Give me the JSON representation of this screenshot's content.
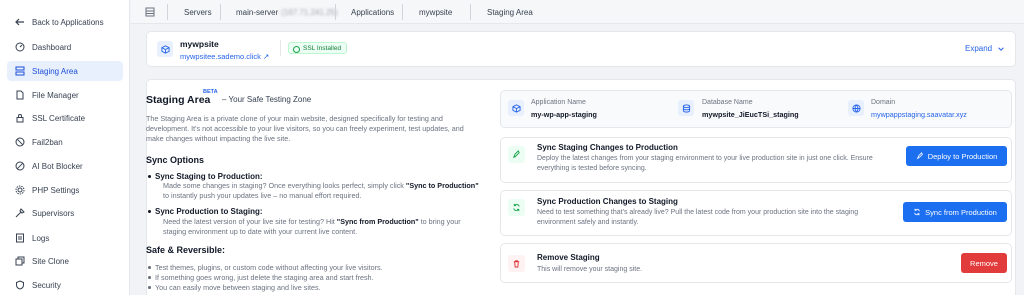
{
  "sidebar": {
    "back_label": "Back to Applications",
    "items": [
      {
        "label": "Dashboard",
        "icon": "dashboard-icon"
      },
      {
        "label": "Staging Area",
        "icon": "staging-icon"
      },
      {
        "label": "File Manager",
        "icon": "file-icon"
      },
      {
        "label": "SSL Certificate",
        "icon": "lock-icon"
      },
      {
        "label": "Fail2ban",
        "icon": "ban-icon"
      },
      {
        "label": "AI Bot Blocker",
        "icon": "block-icon"
      },
      {
        "label": "PHP Settings",
        "icon": "gear-icon"
      },
      {
        "label": "Supervisors",
        "icon": "tools-icon"
      },
      {
        "label": "Logs",
        "icon": "logs-icon"
      },
      {
        "label": "Site Clone",
        "icon": "clone-icon"
      },
      {
        "label": "Security",
        "icon": "shield-icon"
      }
    ],
    "active": "Staging Area"
  },
  "breadcrumb": {
    "servers": "Servers",
    "server": "main-server",
    "server_ip": "(167.71.241.25)",
    "applications": "Applications",
    "app": "mywpsite",
    "current": "Staging Area"
  },
  "site": {
    "name": "mywpsite",
    "url": "mywpsitee.sademo.click",
    "ssl_badge": "SSL Installed",
    "expand_label": "Expand"
  },
  "intro": {
    "title": "Staging Area",
    "beta": "BETA",
    "subtitle": "– Your Safe Testing Zone",
    "lines": [
      "The Staging Area is a private clone of your main website, designed specifically for testing and",
      "development. It's not accessible to your live visitors, so you can freely experiment, test updates, and",
      "make changes without impacting the live site."
    ]
  },
  "sync_options": {
    "heading": "Sync Options",
    "to_prod_title": "Sync Staging to Production:",
    "to_prod_line1": "Made some changes in staging? Once everything looks perfect, simply click ",
    "to_prod_strong": "\"Sync to Production\"",
    "to_prod_line2": "to instantly push your updates live – no manual effort required.",
    "to_staging_title": "Sync Production to Staging:",
    "to_staging_line1a": "Need the latest version of your live site for testing? Hit ",
    "to_staging_strong": "\"Sync from Production\"",
    "to_staging_line1b": " to bring your",
    "to_staging_line2": "staging environment up to date with your current live content."
  },
  "safe": {
    "heading": "Safe & Reversible:",
    "bullets": [
      "Test themes, plugins, or custom code without affecting your live visitors.",
      "If something goes wrong, just delete the staging area and start fresh.",
      "You can easily move between staging and live sites."
    ]
  },
  "staging_info": {
    "app_label": "Application Name",
    "app_value": "my-wp-app-staging",
    "db_label": "Database Name",
    "db_value": "mywpsite_JiEucTSi_staging",
    "domain_label": "Domain",
    "domain_value": "mywpappstaging.saavatar.xyz"
  },
  "actions": {
    "deploy": {
      "title": "Sync Staging Changes to Production",
      "desc1": "Deploy the latest changes from your staging environment to your live production site in just one click. Ensure",
      "desc2": "everything is tested before syncing.",
      "button": "Deploy to Production"
    },
    "sync": {
      "title": "Sync Production Changes to Staging",
      "desc1": "Need to test something that's already live? Pull the latest code from your production site into the staging",
      "desc2": "environment safely and instantly.",
      "button": "Sync from Production"
    },
    "remove": {
      "title": "Remove Staging",
      "desc": "This will remove your staging site.",
      "button": "Remove"
    }
  },
  "colors": {
    "accent": "#1d6ff2",
    "danger": "#e23b3b",
    "success": "#16a34a"
  }
}
